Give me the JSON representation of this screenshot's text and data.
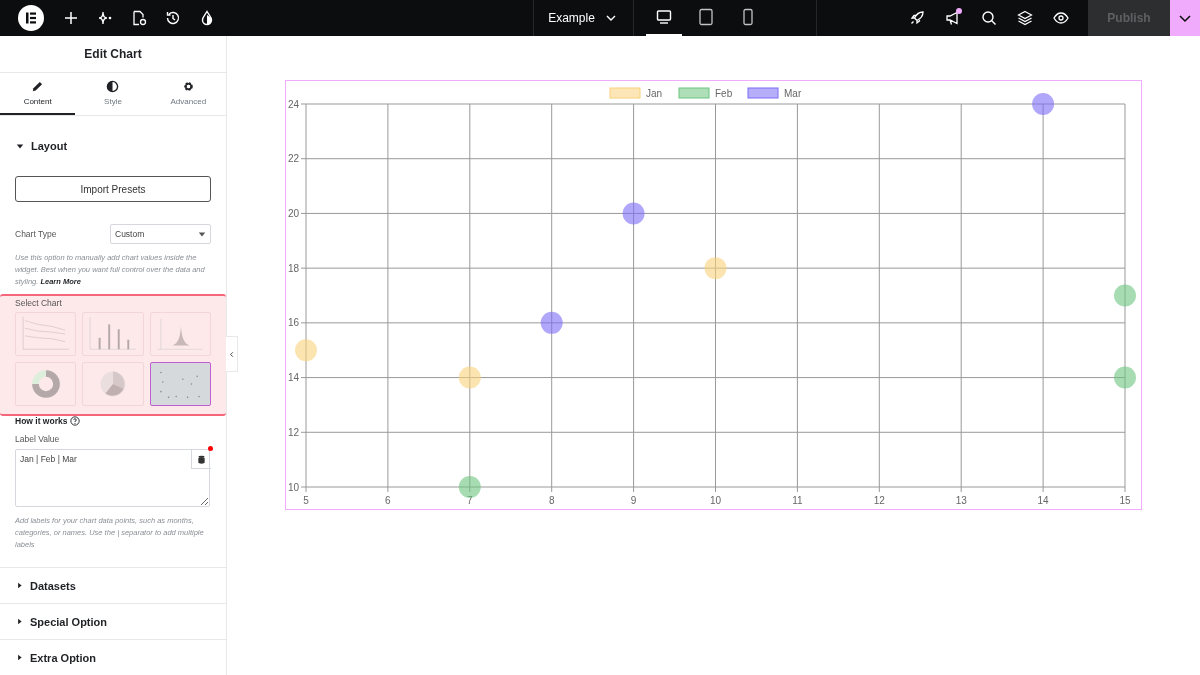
{
  "topbar": {
    "page_title": "Example",
    "devices": [
      {
        "kind": "desktop",
        "selected": true
      },
      {
        "kind": "tablet",
        "selected": false
      },
      {
        "kind": "mobile",
        "selected": false
      }
    ],
    "notification": true,
    "publish": {
      "label": "Publish",
      "disabled": true
    }
  },
  "panel": {
    "title": "Edit Chart",
    "tabs": [
      {
        "label": "Content",
        "kind": "pencil",
        "selected": true
      },
      {
        "label": "Style",
        "kind": "contrast",
        "selected": false
      },
      {
        "label": "Advanced",
        "kind": "gear",
        "selected": false
      }
    ],
    "layout": {
      "title": "Layout",
      "expanded": true,
      "import_button": "Import Presets",
      "chart_type_label": "Chart Type",
      "chart_type_value": "Custom",
      "help": "Use this option to manually add chart values inside the widget. Best when you want full control over the data and styling. ",
      "help_link": "Learn More",
      "select_chart_label": "Select Chart",
      "chart_options": [
        {
          "kind": "line",
          "selected": false
        },
        {
          "kind": "bar",
          "selected": false
        },
        {
          "kind": "radar",
          "selected": false
        },
        {
          "kind": "donut",
          "selected": false
        },
        {
          "kind": "pie",
          "selected": false
        },
        {
          "kind": "scatter",
          "selected": true
        }
      ],
      "how_it_works": "How it works",
      "label_value_label": "Label Value",
      "label_value": "Jan | Feb | Mar",
      "label_help": "Add labels for your chart data points, such as months, categories, or names. Use the | separator to add multiple labels"
    },
    "sections": [
      {
        "title": "Datasets",
        "expanded": false
      },
      {
        "title": "Special Option",
        "expanded": false
      },
      {
        "title": "Extra Option",
        "expanded": false
      }
    ]
  },
  "canvas": {
    "chart_data": {
      "type": "scatter",
      "xlim": [
        5,
        15
      ],
      "ylim": [
        10,
        24
      ],
      "xticks": [
        5,
        6,
        7,
        8,
        9,
        10,
        11,
        12,
        13,
        14,
        15
      ],
      "yticks": [
        10,
        12,
        14,
        16,
        18,
        20,
        22,
        24
      ],
      "series": [
        {
          "name": "Jan",
          "color": "#f9d27b",
          "x": [
            5,
            7,
            10
          ],
          "values": [
            15,
            14,
            18
          ]
        },
        {
          "name": "Feb",
          "color": "#6cc47f",
          "x": [
            7,
            15,
            15
          ],
          "values": [
            10,
            17,
            14
          ]
        },
        {
          "name": "Mar",
          "color": "#7b6cf6",
          "x": [
            9,
            8,
            14
          ],
          "values": [
            20,
            16,
            24
          ]
        }
      ],
      "grid": true,
      "legend": "top"
    }
  }
}
